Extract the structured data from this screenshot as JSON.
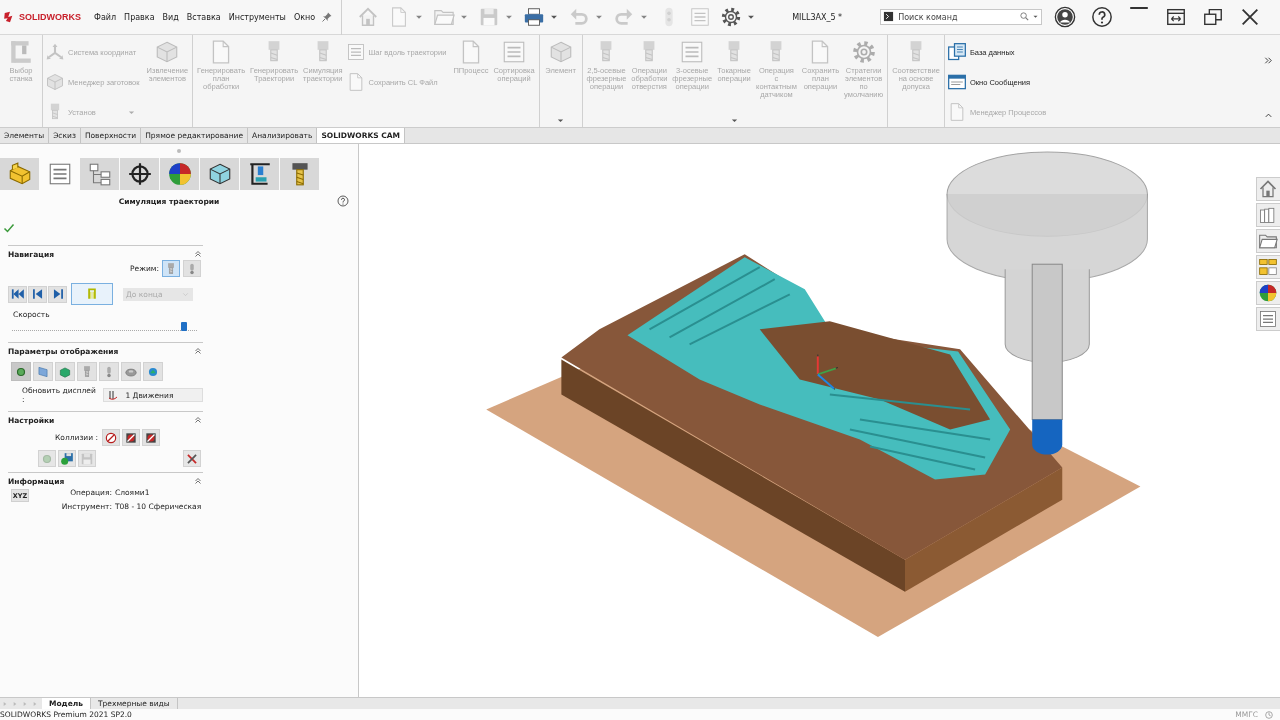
{
  "title_bar": {
    "app_name": "SOLIDWORKS",
    "menu": [
      "Файл",
      "Правка",
      "Вид",
      "Вставка",
      "Инструменты",
      "Окно"
    ],
    "quick_access": [
      {
        "disabled": true,
        "dropdown": false
      },
      {
        "disabled": true,
        "dropdown": true
      },
      {
        "disabled": true,
        "dropdown": true
      },
      {
        "disabled": true,
        "dropdown": true
      },
      {
        "disabled": false,
        "dropdown": true
      },
      {
        "disabled": true,
        "dropdown": true
      },
      {
        "disabled": true,
        "dropdown": true
      },
      {
        "disabled": true,
        "dropdown": false
      },
      {
        "disabled": true,
        "dropdown": false
      },
      {
        "disabled": false,
        "dropdown": true
      }
    ],
    "document_title": "MILL3AX_5 *",
    "search": {
      "placeholder": "Поиск команд"
    }
  },
  "ribbon": {
    "groups": [
      {
        "items": [
          {
            "label": "Выбор станка",
            "kind": "large",
            "disabled": true
          }
        ]
      },
      {
        "items": [
          {
            "label": "Система координат",
            "kind": "small",
            "disabled": true
          },
          {
            "label": "Менеджер заготовок",
            "kind": "small",
            "disabled": true
          },
          {
            "label": "Установ",
            "kind": "small",
            "disabled": true,
            "dropdown": true
          },
          {
            "label": "Извлечение элементов",
            "kind": "large",
            "disabled": true
          }
        ]
      },
      {
        "items": [
          {
            "label": "Генерировать план обработки",
            "kind": "large",
            "disabled": true
          },
          {
            "label": "Генерировать Траектории",
            "kind": "large",
            "disabled": true
          },
          {
            "label": "Симуляция траектории",
            "kind": "large",
            "disabled": true
          },
          {
            "label": "Шаг вдоль траектории",
            "kind": "small",
            "disabled": true
          },
          {
            "label": "Сохранить CL Файл",
            "kind": "small",
            "disabled": true
          },
          {
            "label": "ППроцесс",
            "kind": "large",
            "disabled": true
          },
          {
            "label": "Сортировка операций",
            "kind": "large",
            "disabled": true
          }
        ]
      },
      {
        "more": true,
        "items": [
          {
            "label": "Элемент",
            "kind": "large",
            "disabled": true
          }
        ]
      },
      {
        "more": true,
        "items": [
          {
            "label": "2,5-осевые фрезерные операции",
            "kind": "large",
            "disabled": true
          },
          {
            "label": "Операции обработки отверстия",
            "kind": "large",
            "disabled": true
          },
          {
            "label": "3-осевые фрезерные операции",
            "kind": "large",
            "disabled": true
          },
          {
            "label": "Токарные операции",
            "kind": "large",
            "disabled": true
          },
          {
            "label": "Операция с контактным датчиком",
            "kind": "large",
            "disabled": true
          },
          {
            "label": "Сохранить план операции",
            "kind": "large",
            "disabled": true
          },
          {
            "label": "Стратегии элементов по умолчанию",
            "kind": "large",
            "disabled": true
          }
        ]
      },
      {
        "items": [
          {
            "label": "Соответствие на основе допуска",
            "kind": "large",
            "disabled": true
          }
        ]
      },
      {
        "items": [
          {
            "label": "База данных",
            "kind": "small",
            "disabled": false
          },
          {
            "label": "Окно Сообщения",
            "kind": "small",
            "disabled": false
          },
          {
            "label": "Менеджер Процессов",
            "kind": "small",
            "disabled": true
          }
        ]
      }
    ]
  },
  "command_tabs": [
    {
      "label": "Элементы",
      "selected": false
    },
    {
      "label": "Эскиз",
      "selected": false
    },
    {
      "label": "Поверхности",
      "selected": false
    },
    {
      "label": "Прямое редактирование",
      "selected": false
    },
    {
      "label": "Анализировать",
      "selected": false
    },
    {
      "label": "SOLIDWORKS CAM",
      "selected": true
    }
  ],
  "property_panel": {
    "tabs": [
      {
        "selected": false
      },
      {
        "selected": true
      },
      {
        "selected": false
      },
      {
        "selected": false
      },
      {
        "selected": false
      },
      {
        "selected": false
      },
      {
        "selected": false
      },
      {
        "selected": false
      }
    ],
    "title": "Симуляция траектории",
    "navigation": {
      "title": "Навигация",
      "mode_label": "Режим:",
      "modes": [
        {
          "selected": true
        },
        {
          "selected": false
        }
      ],
      "stop_at": {
        "value": "До конца",
        "disabled": true
      },
      "speed_label": "Скорость",
      "speed": {
        "level": 0.93
      }
    },
    "display": {
      "title": "Параметры отображения",
      "options": [
        {
          "selected": true
        },
        {
          "selected": false
        },
        {
          "selected": false
        },
        {
          "selected": false
        },
        {
          "selected": false
        },
        {
          "selected": false
        },
        {
          "selected": false
        }
      ],
      "update_label": "Обновить дисплей :",
      "update_value": "1 Движения"
    },
    "settings": {
      "title": "Настройки",
      "collisions_label": "Коллизии :",
      "actions": [
        {
          "disabled": true
        },
        {
          "disabled": false
        },
        {
          "disabled": true
        }
      ]
    },
    "info": {
      "title": "Информация",
      "xyz_button": "XYZ",
      "fields": [
        {
          "label": "Операция:",
          "value": "Слоями1"
        },
        {
          "label": "Инструмент:",
          "value": "T08 - 10 Сферическая"
        }
      ]
    }
  },
  "bottom_tabs": [
    {
      "label": "Модель",
      "selected": true
    },
    {
      "label": "Трехмерные виды",
      "selected": false
    }
  ],
  "status_bar": {
    "product": "SOLIDWORKS Premium 2021 SP2.0",
    "units": "ММГС"
  }
}
